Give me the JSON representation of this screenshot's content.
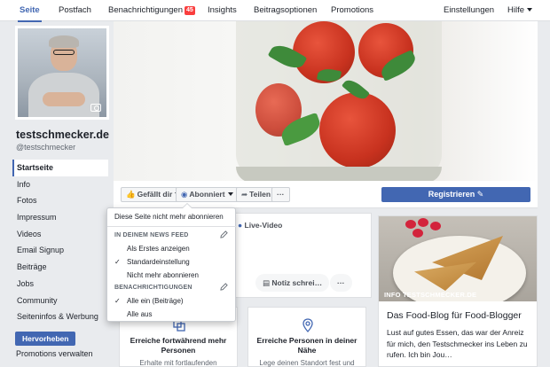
{
  "nav": {
    "tabs": [
      {
        "label": "Seite"
      },
      {
        "label": "Postfach"
      },
      {
        "label": "Benachrichtigungen",
        "badge": "45"
      },
      {
        "label": "Insights"
      },
      {
        "label": "Beitragsoptionen"
      },
      {
        "label": "Promotions"
      },
      {
        "label": "Einstellungen"
      },
      {
        "label": "Hilfe"
      }
    ]
  },
  "page": {
    "name": "testschmecker.de",
    "handle": "@testschmecker"
  },
  "leftnav": {
    "items": [
      {
        "label": "Startseite"
      },
      {
        "label": "Info"
      },
      {
        "label": "Fotos"
      },
      {
        "label": "Impressum"
      },
      {
        "label": "Videos"
      },
      {
        "label": "Email Signup"
      },
      {
        "label": "Beiträge"
      },
      {
        "label": "Jobs"
      },
      {
        "label": "Community"
      },
      {
        "label": "Seiteninfos & Werbung"
      }
    ],
    "promote_button": "Hervorheben",
    "promo_manage": "Promotions verwalten"
  },
  "actions": {
    "like": "Gefällt dir",
    "follow": "Abonniert",
    "share": "Teilen",
    "more": "···",
    "register": "Registrieren"
  },
  "composer": {
    "live": "Live-Video",
    "chip_note": "Notiz schrei…",
    "chip_more": "···"
  },
  "cards": [
    {
      "title": "Erreiche fortwährend mehr Personen",
      "sub": "Erhalte mit fortlaufenden"
    },
    {
      "title": "Erreiche Personen in deiner Nähe",
      "sub": "Lege deinen Standort fest und"
    }
  ],
  "sidebar_card": {
    "image_caption": "INFO TESTSCHMECKER.DE",
    "title": "Das Food-Blog für Food-Blogger",
    "text": "Lust auf gutes Essen, das war der Anreiz für mich, den Testschmecker ins Leben zu rufen. Ich bin Jou…"
  },
  "dropdown": {
    "unfollow_page": "Diese Seite nicht mehr abonnieren",
    "section_feed": "IN DEINEM NEWS FEED",
    "feed_options": [
      {
        "label": "Als Erstes anzeigen",
        "checked": false
      },
      {
        "label": "Standardeinstellung",
        "checked": true
      },
      {
        "label": "Nicht mehr abonnieren",
        "checked": false
      }
    ],
    "section_notifications": "BENACHRICHTIGUNGEN",
    "notification_options": [
      {
        "label": "Alle ein (Beiträge)",
        "checked": true
      },
      {
        "label": "Alle aus",
        "checked": false
      }
    ]
  },
  "colors": {
    "brand": "#4267b2",
    "badge": "#fa3e3e"
  }
}
